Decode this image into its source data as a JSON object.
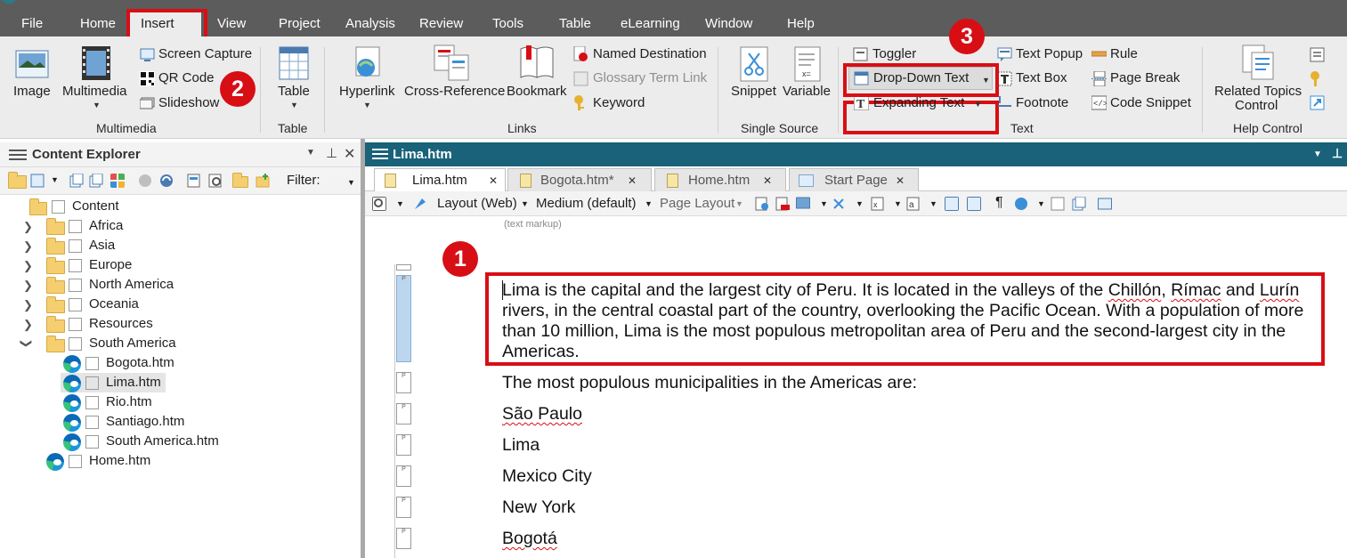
{
  "menu": {
    "items": [
      "File",
      "Home",
      "Insert",
      "View",
      "Project",
      "Analysis",
      "Review",
      "Tools",
      "Table",
      "eLearning",
      "Window",
      "Help"
    ],
    "active": "Insert"
  },
  "ribbon": {
    "multimedia": {
      "image": "Image",
      "multimedia": "Multimedia",
      "screen_capture": "Screen Capture",
      "qr_code": "QR Code",
      "slideshow": "Slideshow",
      "group": "Multimedia"
    },
    "table": {
      "table": "Table",
      "group": "Table"
    },
    "links": {
      "hyperlink": "Hyperlink",
      "cross_reference": "Cross-Reference",
      "bookmark": "Bookmark",
      "named_destination": "Named Destination",
      "glossary_term_link": "Glossary Term Link",
      "keyword": "Keyword",
      "group": "Links"
    },
    "single_source": {
      "snippet": "Snippet",
      "variable": "Variable",
      "group": "Single Source"
    },
    "text": {
      "toggler": "Toggler",
      "drop_down_text": "Drop-Down Text",
      "expanding_text": "Expanding Text",
      "text_popup": "Text Popup",
      "text_box": "Text Box",
      "footnote": "Footnote",
      "rule": "Rule",
      "page_break": "Page Break",
      "code_snippet": "Code Snippet",
      "group": "Text"
    },
    "help_control": {
      "related_topics_1": "Related Topics",
      "related_topics_2": "Control",
      "group": "Help Control"
    }
  },
  "badges": {
    "one": "1",
    "two": "2",
    "three": "3"
  },
  "content_explorer": {
    "title": "Content Explorer",
    "filter_label": "Filter:",
    "tree": {
      "root": "Content",
      "africa": "Africa",
      "asia": "Asia",
      "europe": "Europe",
      "north_america": "North America",
      "oceania": "Oceania",
      "resources": "Resources",
      "south_america": "South America",
      "bogota": "Bogota.htm",
      "lima": "Lima.htm",
      "rio": "Rio.htm",
      "santiago": "Santiago.htm",
      "south_america_htm": "South America.htm",
      "home": "Home.htm"
    }
  },
  "editor": {
    "title": "Lima.htm",
    "tabs": [
      "Lima.htm",
      "Bogota.htm*",
      "Home.htm",
      "Start Page"
    ],
    "toolbar": {
      "layout": "Layout (Web)",
      "medium": "Medium (default)",
      "page_layout": "Page Layout"
    },
    "markup_hint": "(text markup)",
    "paragraph": {
      "line1_a": "Lima is the capital and the largest city of Peru. It is located in the valleys of the ",
      "chillon": "Chillón",
      "sep1": ", ",
      "rimac": "Rímac",
      "and": " and ",
      "lurin": "Lurín",
      "line2": "rivers, in the central coastal part of the country, overlooking the Pacific Ocean. With a population of more",
      "line3": "than 10 million, Lima is the most populous metropolitan area of Peru and the second-largest city in the",
      "line4": "Americas."
    },
    "intro": "The most populous municipalities in the Americas are:",
    "cities": [
      "São Paulo",
      "Lima",
      "Mexico City",
      "New York",
      "Bogotá"
    ]
  },
  "colors": {
    "highlight_red": "#d80e15",
    "title_teal": "#19627a",
    "menubar": "#5c5c5c"
  }
}
